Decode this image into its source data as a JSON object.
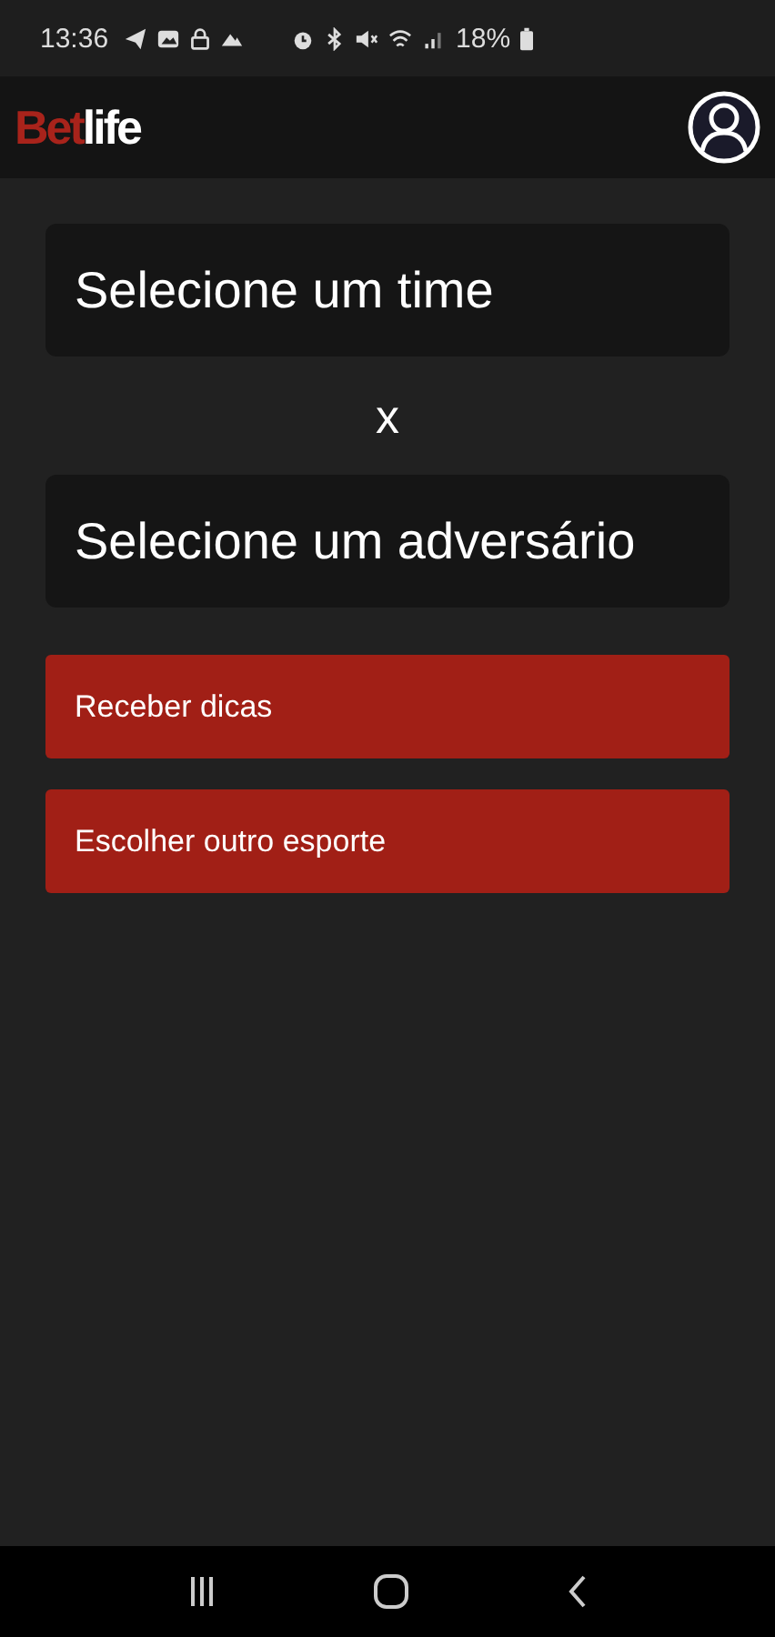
{
  "status_bar": {
    "time": "13:36",
    "battery": "18%"
  },
  "app_bar": {
    "logo_prefix": "Bet",
    "logo_suffix": "life"
  },
  "team_select": {
    "placeholder": "Selecione um time"
  },
  "versus": "x",
  "opponent_select": {
    "placeholder": "Selecione um adversário"
  },
  "buttons": [
    {
      "label": "Receber dicas"
    },
    {
      "label": "Escolher outro esporte"
    }
  ]
}
